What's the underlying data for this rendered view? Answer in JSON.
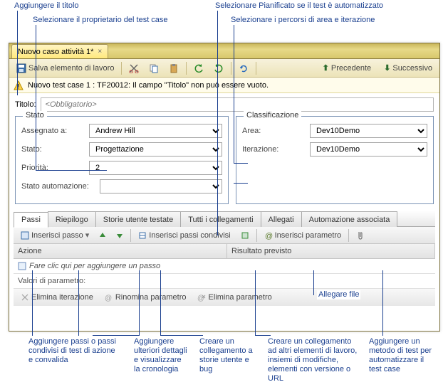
{
  "annotations": {
    "add_title": "Aggiungere il titolo",
    "select_owner": "Selezionare il proprietario del test case",
    "select_planned": "Selezionare Pianificato se il test è automatizzato",
    "select_paths": "Selezionare i percorsi di area e iterazione",
    "add_steps": "Aggiungere passi o passi condivisi di test di azione e convalida",
    "add_details": "Aggiungere ulteriori dettagli e visualizzare la cronologia",
    "create_link_stories": "Creare un collegamento a storie utente e bug",
    "create_link_items": "Creare un collegamento ad altri elementi di lavoro, insiemi di modifiche, elementi con versione o URL",
    "add_method": "Aggiungere un metodo di test per automatizzare il test case",
    "attach_file": "Allegare file"
  },
  "doc_tab": "Nuovo caso attività 1*",
  "toolbar": {
    "save": "Salva elemento di lavoro",
    "prev": "Precedente",
    "next": "Successivo"
  },
  "warning": "Nuovo test case 1 : TF20012: Il campo \"Titolo\" non può essere vuoto.",
  "title_label": "Titolo:",
  "title_placeholder": "<Obbligatorio>",
  "stato_group": {
    "legend": "Stato",
    "assigned_label": "Assegnato a:",
    "assigned_value": "Andrew Hill",
    "state_label": "Stato:",
    "state_value": "Progettazione",
    "priority_label": "Priorità:",
    "priority_value": "2",
    "automation_label": "Stato automazione:",
    "automation_value": ""
  },
  "class_group": {
    "legend": "Classificazione",
    "area_label": "Area:",
    "area_value": "Dev10Demo",
    "iter_label": "Iterazione:",
    "iter_value": "Dev10Demo"
  },
  "tabs": {
    "passi": "Passi",
    "riepilogo": "Riepilogo",
    "storie": "Storie utente testate",
    "tutti": "Tutti i collegamenti",
    "allegati": "Allegati",
    "auto": "Automazione associata"
  },
  "step_toolbar": {
    "insert_step": "Inserisci passo",
    "insert_shared": "Inserisci passi condivisi",
    "insert_param": "Inserisci parametro"
  },
  "grid": {
    "action": "Azione",
    "expected": "Risultato previsto",
    "placeholder": "Fare clic qui per aggiungere un passo"
  },
  "params": {
    "header": "Valori di parametro:",
    "delete_iter": "Elimina iterazione",
    "rename": "Rinomina parametro",
    "delete_param": "Elimina parametro"
  }
}
